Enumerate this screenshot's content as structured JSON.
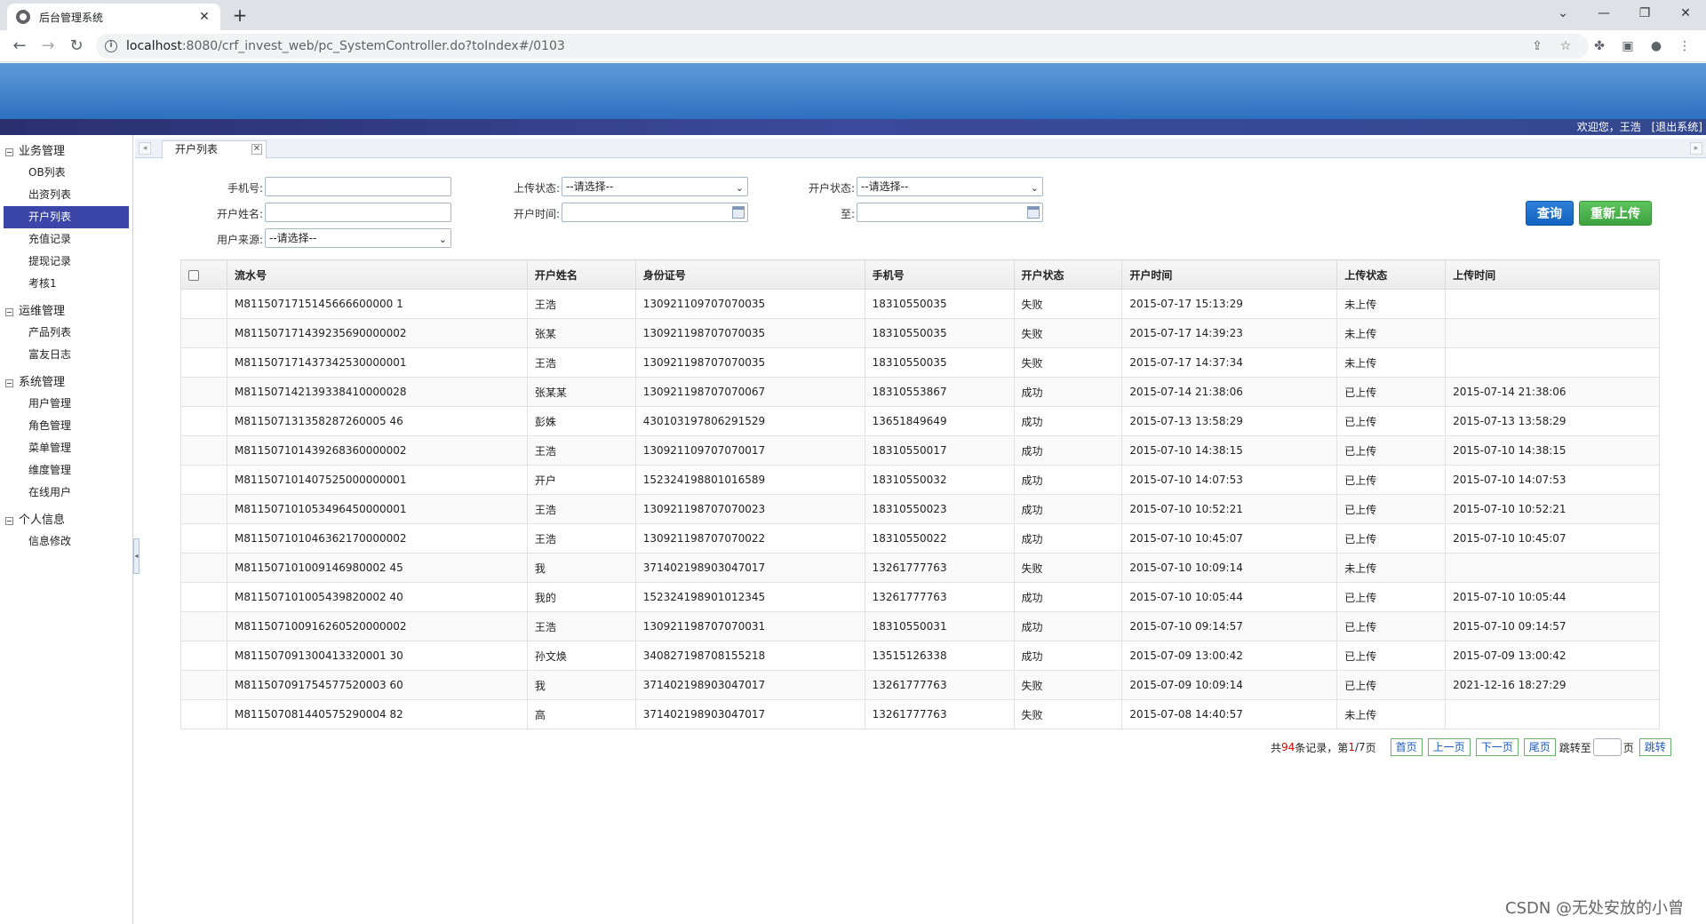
{
  "browser": {
    "tab_title": "后台管理系统",
    "tab_close": "✕",
    "new_tab": "+",
    "url_host": "localhost",
    "url_path": ":8080/crf_invest_web/pc_SystemController.do?toIndex#/0103",
    "window_controls": [
      "⌄",
      "—",
      "❐",
      "✕"
    ]
  },
  "header": {
    "welcome": "欢迎您，王浩",
    "logout": "[退出系统]"
  },
  "sidebar": {
    "groups": [
      {
        "title": "业务管理",
        "items": [
          "OB列表",
          "出资列表",
          "开户列表",
          "充值记录",
          "提现记录",
          "考核1"
        ]
      },
      {
        "title": "运维管理",
        "items": [
          "产品列表",
          "富友日志"
        ]
      },
      {
        "title": "系统管理",
        "items": [
          "用户管理",
          "角色管理",
          "菜单管理",
          "维度管理",
          "在线用户"
        ]
      },
      {
        "title": "个人信息",
        "items": [
          "信息修改"
        ]
      }
    ],
    "active_item": "开户列表"
  },
  "content_tab": {
    "label": "开户列表",
    "close": "✕"
  },
  "form": {
    "phone_label": "手机号:",
    "phone_value": "",
    "name_label": "开户姓名:",
    "name_value": "",
    "source_label": "用户来源:",
    "source_value": "--请选择--",
    "upload_status_label": "上传状态:",
    "upload_status_value": "--请选择--",
    "open_time_label": "开户时间:",
    "open_status_label": "开户状态:",
    "open_status_value": "--请选择--",
    "to_label": "至:",
    "query_button": "查询",
    "reupload_button": "重新上传"
  },
  "table": {
    "columns": [
      "流水号",
      "开户姓名",
      "身份证号",
      "手机号",
      "开户状态",
      "开户时间",
      "上传状态",
      "上传时间"
    ],
    "rows": [
      [
        "M8115071715145666600000 1",
        "王浩",
        "130921109707070035",
        "18310550035",
        "失败",
        "2015-07-17 15:13:29",
        "未上传",
        ""
      ],
      [
        "M811507171439235690000002",
        "张某",
        "130921198707070035",
        "18310550035",
        "失败",
        "2015-07-17 14:39:23",
        "未上传",
        ""
      ],
      [
        "M811507171437342530000001",
        "王浩",
        "130921198707070035",
        "18310550035",
        "失败",
        "2015-07-17 14:37:34",
        "未上传",
        ""
      ],
      [
        "M811507142139338410000028",
        "张某某",
        "130921198707070067",
        "18310553867",
        "成功",
        "2015-07-14 21:38:06",
        "已上传",
        "2015-07-14 21:38:06"
      ],
      [
        "M811507131358287260005 46",
        "彭姝",
        "430103197806291529",
        "13651849649",
        "成功",
        "2015-07-13 13:58:29",
        "已上传",
        "2015-07-13 13:58:29"
      ],
      [
        "M811507101439268360000002",
        "王浩",
        "130921109707070017",
        "18310550017",
        "成功",
        "2015-07-10 14:38:15",
        "已上传",
        "2015-07-10 14:38:15"
      ],
      [
        "M811507101407525000000001",
        "开户",
        "152324198801016589",
        "18310550032",
        "成功",
        "2015-07-10 14:07:53",
        "已上传",
        "2015-07-10 14:07:53"
      ],
      [
        "M811507101053496450000001",
        "王浩",
        "130921198707070023",
        "18310550023",
        "成功",
        "2015-07-10 10:52:21",
        "已上传",
        "2015-07-10 10:52:21"
      ],
      [
        "M811507101046362170000002",
        "王浩",
        "130921198707070022",
        "18310550022",
        "成功",
        "2015-07-10 10:45:07",
        "已上传",
        "2015-07-10 10:45:07"
      ],
      [
        "M811507101009146980002 45",
        "我",
        "371402198903047017",
        "13261777763",
        "失败",
        "2015-07-10 10:09:14",
        "未上传",
        ""
      ],
      [
        "M811507101005439820002 40",
        "我的",
        "152324198901012345",
        "13261777763",
        "成功",
        "2015-07-10 10:05:44",
        "已上传",
        "2015-07-10 10:05:44"
      ],
      [
        "M811507100916260520000002",
        "王浩",
        "130921198707070031",
        "18310550031",
        "成功",
        "2015-07-10 09:14:57",
        "已上传",
        "2015-07-10 09:14:57"
      ],
      [
        "M811507091300413320001 30",
        "孙文焕",
        "340827198708155218",
        "13515126338",
        "成功",
        "2015-07-09 13:00:42",
        "已上传",
        "2015-07-09 13:00:42"
      ],
      [
        "M811507091754577520003 60",
        "我",
        "371402198903047017",
        "13261777763",
        "失败",
        "2015-07-09 10:09:14",
        "已上传",
        "2021-12-16 18:27:29"
      ],
      [
        "M811507081440575290004 82",
        "高",
        "371402198903047017",
        "13261777763",
        "失败",
        "2015-07-08 14:40:57",
        "未上传",
        ""
      ]
    ]
  },
  "pager": {
    "prefix": "共",
    "total": "94",
    "records_mid": "条记录，第",
    "current": "1",
    "slash": "/",
    "pages": "7",
    "page_suffix": "页",
    "first": "首页",
    "prev": "上一页",
    "next": "下一页",
    "last": "尾页",
    "jump_to": "跳转至",
    "page_unit": "页",
    "go": "跳转"
  },
  "watermark": "CSDN @无处安放的小曾"
}
